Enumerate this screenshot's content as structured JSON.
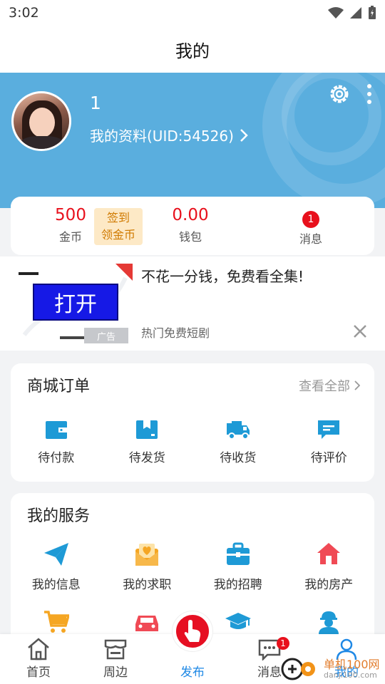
{
  "status": {
    "time": "3:02"
  },
  "header": {
    "title": "我的"
  },
  "profile": {
    "name": "1",
    "link_label": "我的资料(UID:54526)"
  },
  "stats": {
    "coins_value": "500",
    "coins_label": "金币",
    "signin_line1": "签到",
    "signin_line2": "领金币",
    "wallet_value": "0.00",
    "wallet_label": "钱包",
    "messages_count": "1",
    "messages_label": "消息"
  },
  "ad": {
    "open_label": "打开",
    "ad_tag": "广告",
    "title": "不花一分钱，免费看全集!",
    "subtitle": "热门免费短剧"
  },
  "orders": {
    "title": "商城订单",
    "view_all": "查看全部",
    "items": [
      {
        "label": "待付款",
        "icon": "wallet-icon"
      },
      {
        "label": "待发货",
        "icon": "box-icon"
      },
      {
        "label": "待收货",
        "icon": "truck-icon"
      },
      {
        "label": "待评价",
        "icon": "comment-icon"
      }
    ]
  },
  "services": {
    "title": "我的服务",
    "items": [
      {
        "label": "我的信息",
        "icon": "paper-plane-icon"
      },
      {
        "label": "我的求职",
        "icon": "heart-envelope-icon"
      },
      {
        "label": "我的招聘",
        "icon": "briefcase-icon"
      },
      {
        "label": "我的房产",
        "icon": "house-icon"
      }
    ],
    "row2_icons": [
      "cart-icon",
      "car-icon",
      "graduation-cap-icon",
      "worker-icon"
    ]
  },
  "tabbar": {
    "home": "首页",
    "nearby": "周边",
    "publish": "发布",
    "messages": "消息",
    "messages_badge": "1",
    "mine": "我的"
  },
  "watermark": {
    "text": "单机100网",
    "sub": "danji100.com"
  },
  "colors": {
    "accent_blue": "#5aaede",
    "red": "#e8101c",
    "icon_blue": "#1e9ad6",
    "icon_orange": "#f5a623",
    "icon_red": "#f04a55"
  }
}
